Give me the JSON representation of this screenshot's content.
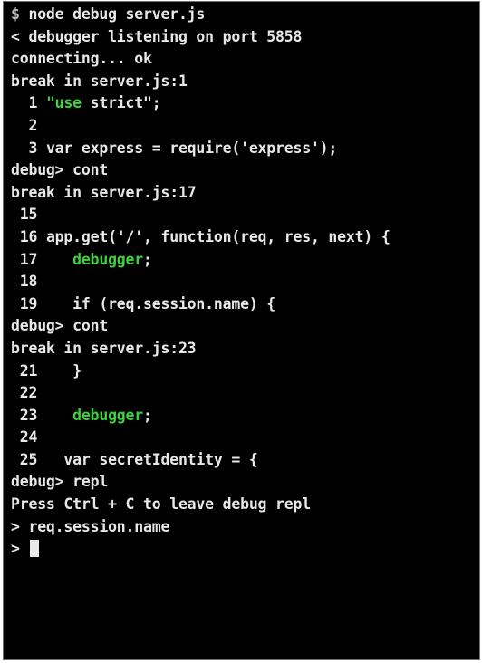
{
  "terminal": {
    "lines": [
      {
        "prefix": "$",
        "text": " node debug server.js"
      },
      {
        "text": "< debugger listening on port 5858"
      },
      {
        "text": "connecting... ok"
      },
      {
        "text": "break in server.js:1"
      },
      {
        "num": "  1 ",
        "green": "\"use",
        "rest": " strict\";"
      },
      {
        "num": "  2"
      },
      {
        "num": "  3 ",
        "rest": "var express = require('express');"
      },
      {
        "text": "debug> cont"
      },
      {
        "text": "break in server.js:17"
      },
      {
        "num": " 15"
      },
      {
        "num": " 16 ",
        "rest": "app.get('/', function(req, res, next) {"
      },
      {
        "num": " 17 ",
        "green": "   debugger",
        "rest": ";"
      },
      {
        "num": " 18"
      },
      {
        "num": " 19 ",
        "rest": "   if (req.session.name) {"
      },
      {
        "text": "debug> cont"
      },
      {
        "text": "break in server.js:23"
      },
      {
        "num": " 21 ",
        "rest": "   }"
      },
      {
        "num": " 22"
      },
      {
        "num": " 23 ",
        "green": "   debugger",
        "rest": ";"
      },
      {
        "num": " 24"
      },
      {
        "num": " 25 ",
        "rest": "  var secretIdentity = {"
      },
      {
        "text": "debug> repl"
      },
      {
        "text": "Press Ctrl + C to leave debug repl"
      },
      {
        "text": "> req.session.name"
      },
      {
        "text": "> "
      }
    ]
  },
  "colors": {
    "background": "#000000",
    "text": "#e8e8e8",
    "prompt": "#bdbdbd",
    "highlight": "#3dd23d"
  }
}
